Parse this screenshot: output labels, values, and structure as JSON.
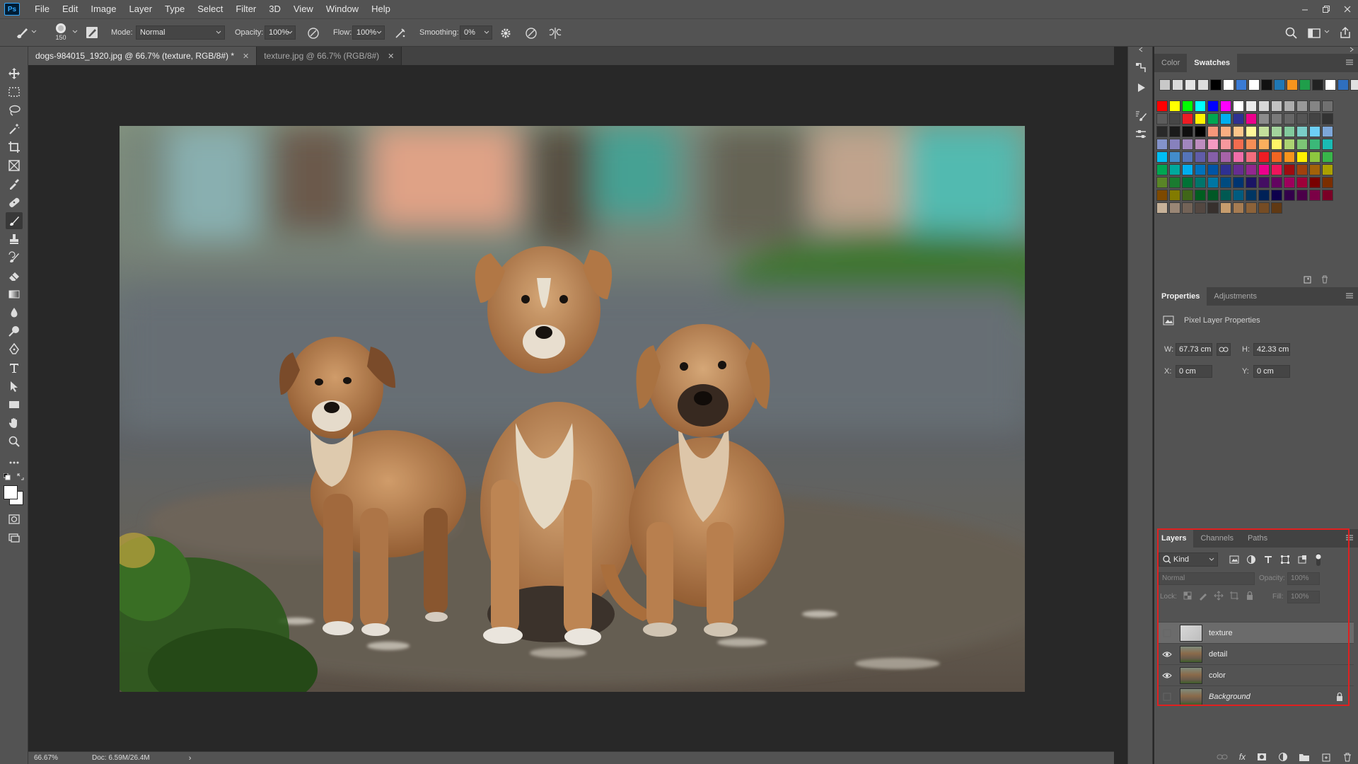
{
  "app": {
    "logo": "Ps"
  },
  "menu": [
    "File",
    "Edit",
    "Image",
    "Layer",
    "Type",
    "Select",
    "Filter",
    "3D",
    "View",
    "Window",
    "Help"
  ],
  "options": {
    "brush_size": "150",
    "mode_label": "Mode:",
    "mode_value": "Normal",
    "opacity_label": "Opacity:",
    "opacity_value": "100%",
    "flow_label": "Flow:",
    "flow_value": "100%",
    "smoothing_label": "Smoothing:",
    "smoothing_value": "0%"
  },
  "doc_tabs": [
    {
      "title": "dogs-984015_1920.jpg @ 66.7% (texture, RGB/8#) *",
      "active": true
    },
    {
      "title": "texture.jpg @ 66.7% (RGB/8#)",
      "active": false
    }
  ],
  "status": {
    "zoom": "66.67%",
    "doc": "Doc: 6.59M/26.4M"
  },
  "color_panel": {
    "tabs": [
      "Color",
      "Swatches"
    ],
    "active_tab": "Swatches",
    "recent_swatches": [
      "#c8c8c8",
      "#d8d8d8",
      "#e4e4e4",
      "#dcdcdc",
      "#000000",
      "#ffffff",
      "#3a7bd5",
      "#ffffff",
      "#111111",
      "#1f77b4",
      "#f7941d",
      "#1f9e4a",
      "#222222",
      "#ffffff",
      "#2f6fbf",
      "#e0e0e0"
    ],
    "swatch_rows": [
      [
        "#ff0000",
        "#ffff00",
        "#00ff00",
        "#00ffff",
        "#0000ff",
        "#ff00ff",
        "#ffffff",
        "#ebebeb",
        "#d6d6d6",
        "#c2c2c2",
        "#adadad",
        "#999999",
        "#858585",
        "#707070"
      ],
      [
        "#5c5c5c",
        "#474747",
        "#ed1c24",
        "#fff200",
        "#00a651",
        "#00aeef",
        "#2e3192",
        "#ec008c",
        "#8c8c8c",
        "#7a7a7a",
        "#676767",
        "#555555",
        "#444444",
        "#333333"
      ],
      [
        "#292929",
        "#1a1a1a",
        "#0f0f0f",
        "#000000",
        "#f7977a",
        "#f9ad81",
        "#fdc68a",
        "#fff79a",
        "#c4df9b",
        "#a3d39c",
        "#82ca9d",
        "#7accc8",
        "#6dcff6",
        "#7da7d9"
      ],
      [
        "#8393ca",
        "#8781bd",
        "#a186be",
        "#bd8cbf",
        "#f49ac1",
        "#f6989d",
        "#f26c4f",
        "#f68e56",
        "#fbaf5d",
        "#fff467",
        "#acd372",
        "#7cc576",
        "#3bb878",
        "#1abbb4"
      ],
      [
        "#00bff3",
        "#438ccb",
        "#5574b9",
        "#605ca8",
        "#855fa8",
        "#a763a8",
        "#f06ea9",
        "#f26d7d",
        "#ed1c24",
        "#f26522",
        "#f7941d",
        "#fff200",
        "#8dc63f",
        "#39b54a"
      ],
      [
        "#00a651",
        "#00a99d",
        "#00aeef",
        "#0072bc",
        "#0054a6",
        "#2e3192",
        "#662d91",
        "#92278f",
        "#ec008c",
        "#ed145b",
        "#9e0b0f",
        "#a0410d",
        "#a36209",
        "#aba000"
      ],
      [
        "#598527",
        "#1a7b30",
        "#007236",
        "#00746b",
        "#0076a3",
        "#004b80",
        "#003471",
        "#1b1464",
        "#440e62",
        "#630460",
        "#9e005d",
        "#9e0039",
        "#790000",
        "#7b2e00"
      ],
      [
        "#7d4900",
        "#827b00",
        "#406618",
        "#005e20",
        "#005826",
        "#005952",
        "#005b7f",
        "#003663",
        "#002157",
        "#0d004c",
        "#32004b",
        "#4b0049",
        "#7b0046",
        "#7a0026"
      ],
      [
        "#c7b299",
        "#998675",
        "#736357",
        "#534741",
        "#37302d",
        "#c69c6d",
        "#a67c52",
        "#8c6239",
        "#754c24",
        "#603913"
      ]
    ]
  },
  "properties_panel": {
    "tabs": [
      "Properties",
      "Adjustments"
    ],
    "active_tab": "Properties",
    "title": "Pixel Layer Properties",
    "w_label": "W:",
    "w_value": "67.73 cm",
    "h_label": "H:",
    "h_value": "42.33 cm",
    "x_label": "X:",
    "x_value": "0 cm",
    "y_label": "Y:",
    "y_value": "0 cm"
  },
  "layers_panel": {
    "tabs": [
      "Layers",
      "Channels",
      "Paths"
    ],
    "active_tab": "Layers",
    "filter_kind": "Kind",
    "blend_mode": "Normal",
    "opacity_label": "Opacity:",
    "opacity_value": "100%",
    "lock_label": "Lock:",
    "fill_label": "Fill:",
    "fill_value": "100%",
    "layers": [
      {
        "name": "texture",
        "visible": false,
        "selected": true,
        "locked": false,
        "italic": false
      },
      {
        "name": "detail",
        "visible": true,
        "selected": false,
        "locked": false,
        "italic": false
      },
      {
        "name": "color",
        "visible": true,
        "selected": false,
        "locked": false,
        "italic": false
      },
      {
        "name": "Background",
        "visible": false,
        "selected": false,
        "locked": true,
        "italic": true
      }
    ]
  },
  "colors": {
    "highlight": "#e02020",
    "foreground": "#ffffff",
    "background": "#ffffff"
  }
}
